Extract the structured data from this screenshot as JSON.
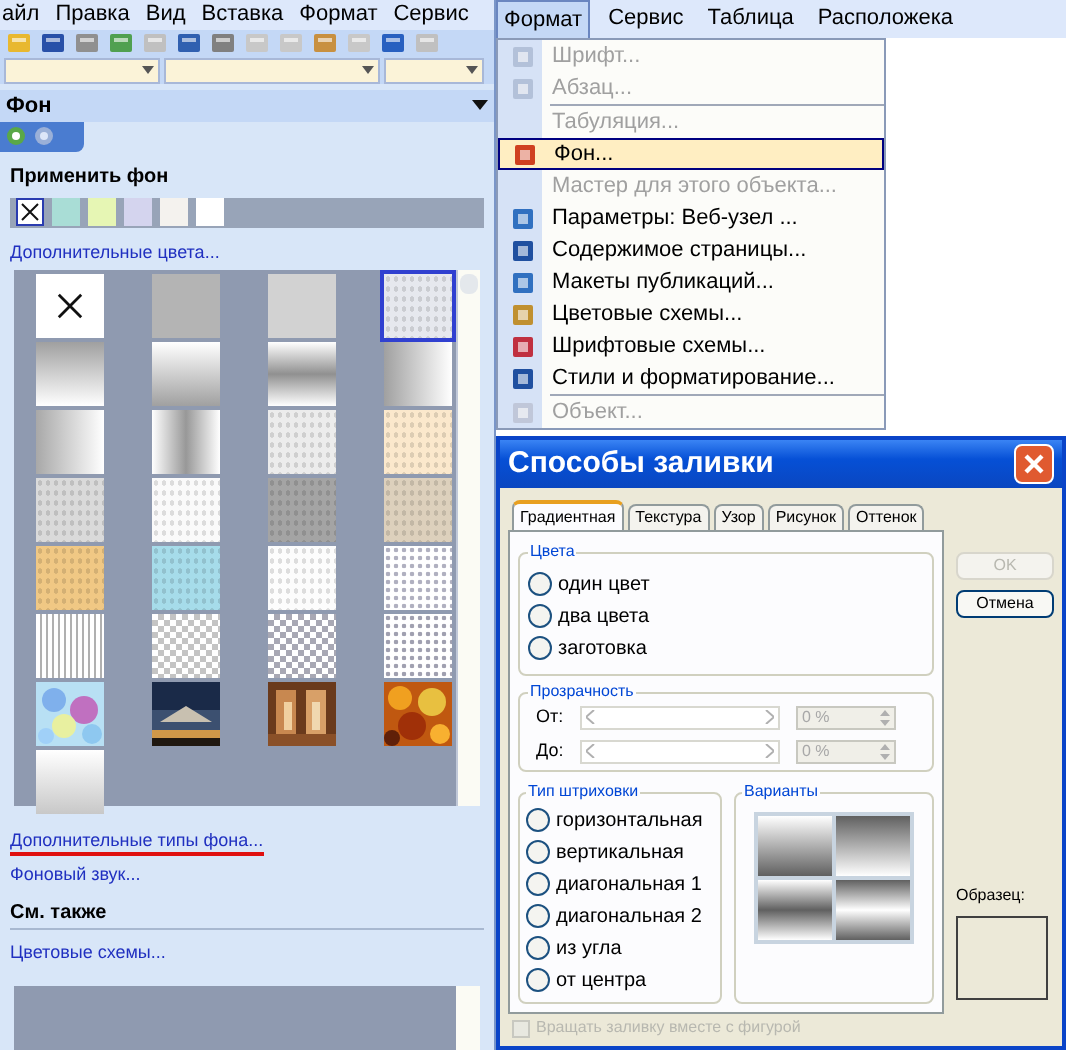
{
  "left_menubar": [
    {
      "label": "айл",
      "selected": false
    },
    {
      "label": "Правка",
      "selected": false
    },
    {
      "label": "Вид",
      "selected": false
    },
    {
      "label": "Вставка",
      "selected": false
    },
    {
      "label": "Формат",
      "selected": false
    },
    {
      "label": "Сервис",
      "selected": false
    }
  ],
  "task_pane": {
    "title": "Фон",
    "apply_label": "Применить фон",
    "swatches": [
      {
        "kind": "none",
        "selected": true
      },
      {
        "kind": "color",
        "color": "#a9ddd6",
        "selected": false
      },
      {
        "kind": "color",
        "color": "#e6f6b4",
        "selected": false
      },
      {
        "kind": "color",
        "color": "#d4d4ee",
        "selected": false
      },
      {
        "kind": "color",
        "color": "#f4f2ee",
        "selected": false
      },
      {
        "kind": "color",
        "color": "#ffffff",
        "selected": false
      }
    ],
    "more_colors_link": "Дополнительные цвета...",
    "tiles": [
      {
        "kind": "none",
        "selected": false
      },
      {
        "kind": "solid",
        "color": "#b4b4b4",
        "selected": false
      },
      {
        "kind": "solid",
        "color": "#d2d2d2",
        "selected": false
      },
      {
        "kind": "texture",
        "color": "#e6e8ee",
        "selected": true
      },
      {
        "kind": "fadeup",
        "color": "#a0a0a0",
        "selected": false
      },
      {
        "kind": "fadedown",
        "color": "#a0a0a0",
        "selected": false
      },
      {
        "kind": "band",
        "color": "#909090",
        "selected": false
      },
      {
        "kind": "side",
        "color": "#a0a0a0",
        "selected": false
      },
      {
        "kind": "side",
        "color": "#a8a8a8",
        "selected": false
      },
      {
        "kind": "column",
        "color": "#989898",
        "selected": false
      },
      {
        "kind": "texture",
        "color": "#ececec",
        "selected": false
      },
      {
        "kind": "texture",
        "color": "#fbe8cc",
        "selected": false
      },
      {
        "kind": "texture",
        "color": "#dadada",
        "selected": false
      },
      {
        "kind": "texture",
        "color": "#fafafa",
        "selected": false
      },
      {
        "kind": "texture",
        "color": "#a4a4a4",
        "selected": false
      },
      {
        "kind": "texture",
        "color": "#ddd0bc",
        "selected": false
      },
      {
        "kind": "texture",
        "color": "#f0c884",
        "selected": false
      },
      {
        "kind": "texture",
        "color": "#a6dcea",
        "selected": false
      },
      {
        "kind": "texture",
        "color": "#fcfcfc",
        "selected": false
      },
      {
        "kind": "dots",
        "color": "#b0b0c0",
        "selected": false
      },
      {
        "kind": "stripes",
        "color": "#b0b0b0",
        "selected": false
      },
      {
        "kind": "checker",
        "color": "#c4c4c4",
        "selected": false
      },
      {
        "kind": "checker",
        "color": "#a8a8b4",
        "selected": false
      },
      {
        "kind": "dots",
        "color": "#a0a0b0",
        "selected": false
      },
      {
        "kind": "picture",
        "selected": false
      },
      {
        "kind": "picture",
        "selected": false
      },
      {
        "kind": "picture",
        "selected": false
      },
      {
        "kind": "picture",
        "selected": false
      },
      {
        "kind": "fadedown",
        "color": "#c8c8c8",
        "selected": false
      }
    ],
    "more_fill_link": "Дополнительные типы фона...",
    "sound_link": "Фоновый звук...",
    "see_also": "См. также",
    "color_schemes_link": "Цветовые схемы..."
  },
  "right_menubar": [
    {
      "label": "Формат",
      "selected": true
    },
    {
      "label": "Сервис",
      "selected": false
    },
    {
      "label": "Таблица",
      "selected": false
    },
    {
      "label": "Расположека",
      "selected": false
    }
  ],
  "format_menu": [
    {
      "kind": "item",
      "label": "Шрифт...",
      "disabled": true,
      "selected": false
    },
    {
      "kind": "item",
      "label": "Абзац...",
      "disabled": true,
      "selected": false
    },
    {
      "kind": "separator"
    },
    {
      "kind": "item",
      "label": "Табуляция...",
      "disabled": true,
      "selected": false
    },
    {
      "kind": "item",
      "label": "Фон...",
      "disabled": false,
      "selected": true
    },
    {
      "kind": "item",
      "label": "Мастер для этого объекта...",
      "disabled": true,
      "selected": false
    },
    {
      "kind": "item",
      "label": "Параметры: Веб-узел ...",
      "disabled": false,
      "selected": false
    },
    {
      "kind": "item",
      "label": "Содержимое страницы...",
      "disabled": false,
      "selected": false
    },
    {
      "kind": "item",
      "label": "Макеты публикаций...",
      "disabled": false,
      "selected": false
    },
    {
      "kind": "item",
      "label": "Цветовые схемы...",
      "disabled": false,
      "selected": false
    },
    {
      "kind": "item",
      "label": "Шрифтовые схемы...",
      "disabled": false,
      "selected": false
    },
    {
      "kind": "item",
      "label": "Стили и форматирование...",
      "disabled": false,
      "selected": false
    },
    {
      "kind": "separator"
    },
    {
      "kind": "item",
      "label": "Объект...",
      "disabled": true,
      "selected": false
    }
  ],
  "dialog": {
    "title": "Способы заливки",
    "tabs": [
      {
        "label": "Градиентная",
        "selected": true
      },
      {
        "label": "Текстура",
        "selected": false
      },
      {
        "label": "Узор",
        "selected": false
      },
      {
        "label": "Рисунок",
        "selected": false
      },
      {
        "label": "Оттенок",
        "selected": false
      }
    ],
    "buttons": [
      {
        "label": "OK",
        "disabled": true
      },
      {
        "label": "Отмена",
        "disabled": false
      }
    ],
    "colors": {
      "title": "Цвета",
      "options": [
        {
          "label": "один цвет",
          "selected": false
        },
        {
          "label": "два цвета",
          "selected": false
        },
        {
          "label": "заготовка",
          "selected": false
        }
      ]
    },
    "transparency": {
      "title": "Прозрачность",
      "rows": [
        {
          "label": "От:",
          "value": "0 %"
        },
        {
          "label": "До:",
          "value": "0 %"
        }
      ]
    },
    "shading": {
      "title": "Тип штриховки",
      "options": [
        {
          "label": "горизонтальная",
          "selected": false
        },
        {
          "label": "вертикальная",
          "selected": false
        },
        {
          "label": "диагональная 1",
          "selected": false
        },
        {
          "label": "диагональная 2",
          "selected": false
        },
        {
          "label": "из угла",
          "selected": false
        },
        {
          "label": "от центра",
          "selected": false
        }
      ]
    },
    "variants": {
      "title": "Варианты"
    },
    "sample_label": "Образец:",
    "rotate": {
      "label": "Вращать заливку вместе с фигурой",
      "checked": false,
      "disabled": true
    }
  }
}
